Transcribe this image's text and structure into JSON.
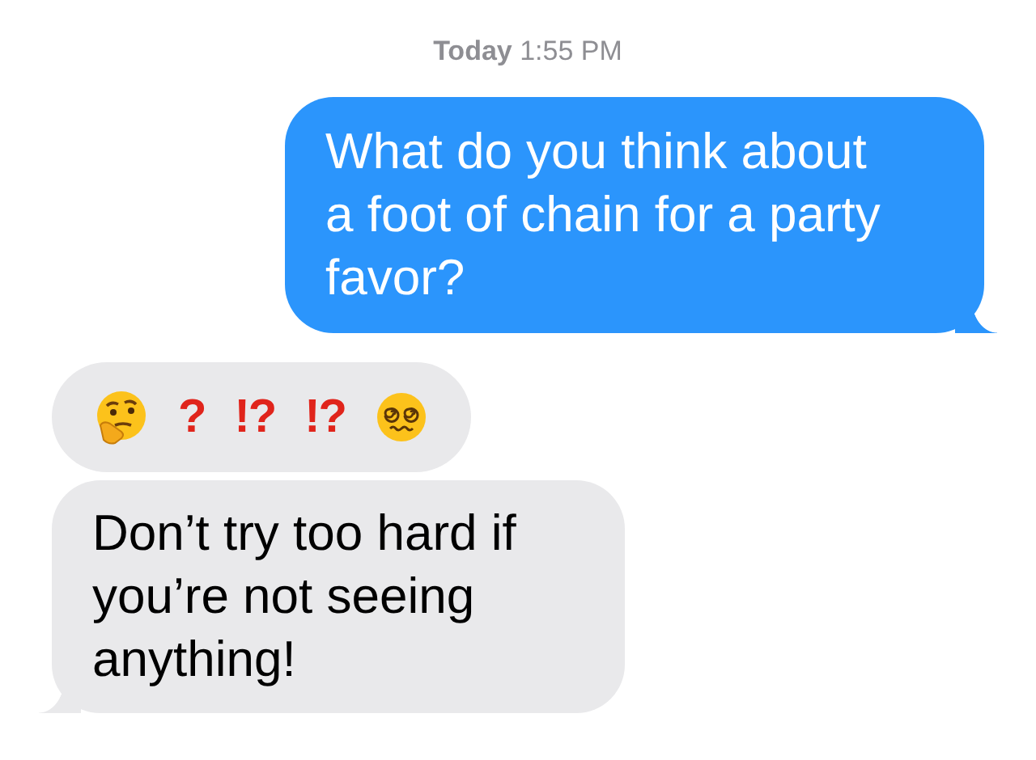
{
  "timestamp": "**Today** 1:55 PM",
  "messages": [
    {
      "kind": "sent",
      "text": "What do you think about a foot of chain for a party favor?"
    },
    {
      "kind": "emoji",
      "items": [
        {
          "kind": "thinking"
        },
        {
          "kind": "mark",
          "text": "?"
        },
        {
          "kind": "mark",
          "text": "!?"
        },
        {
          "kind": "mark",
          "text": "!?"
        },
        {
          "kind": "dizzy"
        }
      ]
    },
    {
      "kind": "received",
      "text": "Don’t try too hard if you’re not seeing anything!"
    }
  ]
}
